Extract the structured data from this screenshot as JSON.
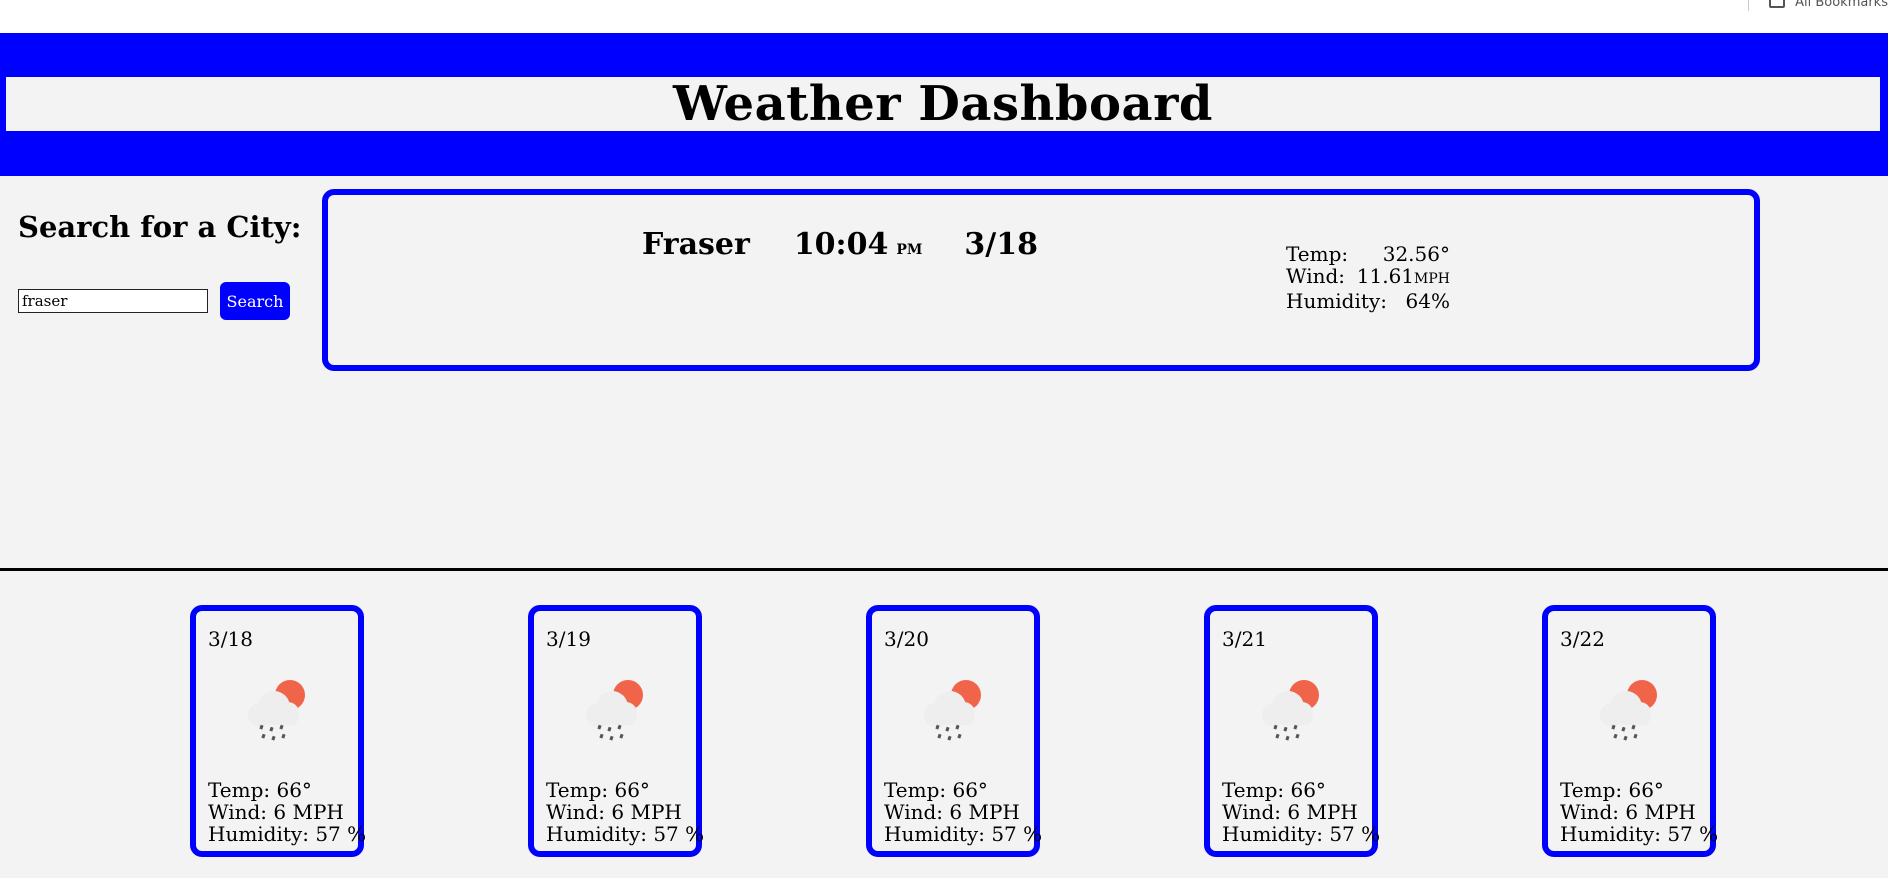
{
  "browser": {
    "bookmarks_label": "All Bookmarks"
  },
  "header": {
    "title": "Weather Dashboard"
  },
  "search": {
    "heading": "Search for a City:",
    "input_value": "fraser",
    "button_label": "Search"
  },
  "current": {
    "city": "Fraser",
    "time": "10:04",
    "ampm": "PM",
    "date": "3/18",
    "temp_label": "Temp:",
    "temp_value": "32.56°",
    "wind_label": "Wind:",
    "wind_value": "11.61",
    "wind_unit": "MPH",
    "humidity_label": "Humidity:",
    "humidity_value": "64%"
  },
  "forecast": [
    {
      "date": "3/18",
      "icon": "rain-cloud-sun-icon",
      "temp": "Temp: 66°",
      "wind": "Wind: 6 MPH",
      "humidity": "Humidity: 57 %"
    },
    {
      "date": "3/19",
      "icon": "rain-cloud-sun-icon",
      "temp": "Temp: 66°",
      "wind": "Wind: 6 MPH",
      "humidity": "Humidity: 57 %"
    },
    {
      "date": "3/20",
      "icon": "rain-cloud-sun-icon",
      "temp": "Temp: 66°",
      "wind": "Wind: 6 MPH",
      "humidity": "Humidity: 57 %"
    },
    {
      "date": "3/21",
      "icon": "rain-cloud-sun-icon",
      "temp": "Temp: 66°",
      "wind": "Wind: 6 MPH",
      "humidity": "Humidity: 57 %"
    },
    {
      "date": "3/22",
      "icon": "rain-cloud-sun-icon",
      "temp": "Temp: 66°",
      "wind": "Wind: 6 MPH",
      "humidity": "Humidity: 57 %"
    }
  ],
  "colors": {
    "accent": "#0000ff",
    "background": "#f3f3f3",
    "sun": "#f0654a"
  }
}
